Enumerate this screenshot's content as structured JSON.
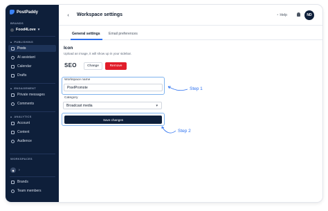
{
  "sidebar": {
    "logo_text": "PostPaddy",
    "brands_label": "BRANDS",
    "brand_name": "Food4Love",
    "groups": {
      "publishing": "PUBLISHING",
      "engagement": "ENGAGEMENT",
      "analytics": "ANALYTICS"
    },
    "items": {
      "posts": "Posts",
      "ai_assistant": "AI assistant",
      "calendar": "Calendar",
      "drafts": "Drafts",
      "private_messages": "Private messages",
      "comments": "Comments",
      "account": "Account",
      "content": "Content",
      "audience": "Audience",
      "brands": "Brands",
      "team_members": "Team members"
    },
    "workspaces_label": "WORKSPACES"
  },
  "header": {
    "title": "Workspace settings",
    "help_label": "Help",
    "avatar_initials": "ND"
  },
  "tabs": {
    "general": "General settings",
    "email": "Email preferences"
  },
  "icon_section": {
    "title": "Icon",
    "subtitle": "Upload an image, it will show up in your sidebar.",
    "logo_text": "SEO",
    "change_label": "Change",
    "remove_label": "Remove"
  },
  "form": {
    "workspace_name_label": "Workspace name",
    "workspace_name_value": "PixelPromote",
    "category_label": "Category",
    "category_value": "Broadcast media",
    "save_label": "Save changes"
  },
  "annotations": {
    "step1": "Step 1",
    "step2": "Step 2"
  },
  "colors": {
    "sidebar_bg": "#0e1f3a",
    "accent": "#2a6ff0",
    "danger": "#e11d2a",
    "primary_button": "#0e1f3a"
  }
}
